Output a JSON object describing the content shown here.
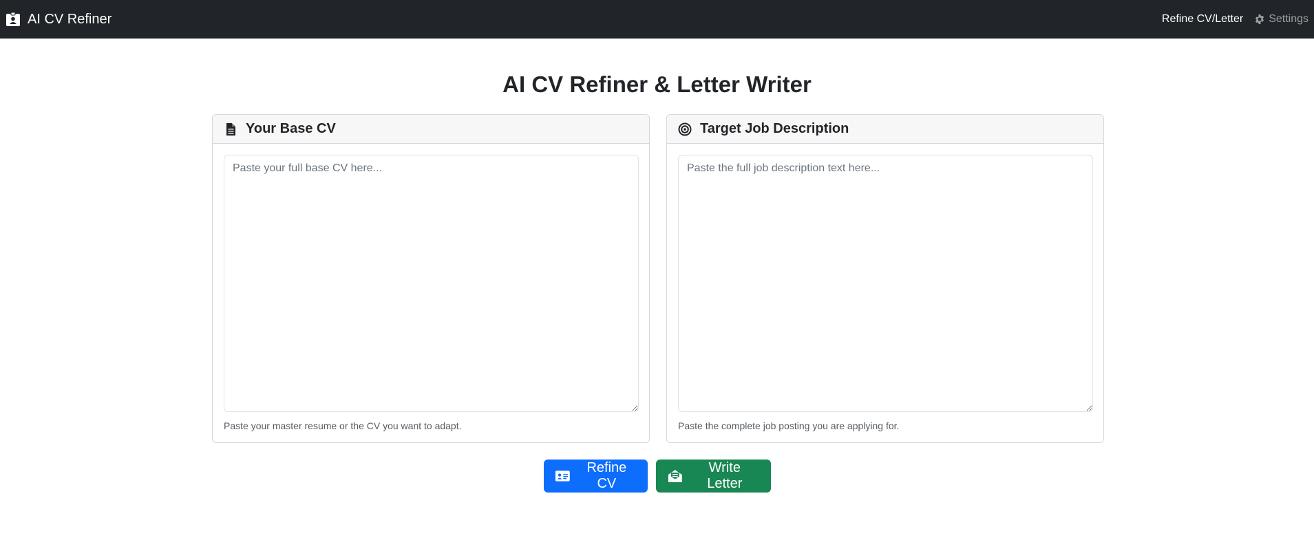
{
  "navbar": {
    "brand": "AI CV Refiner",
    "links": [
      {
        "label": "Refine CV/Letter",
        "icon": "none"
      },
      {
        "label": "Settings",
        "icon": "gear-icon"
      }
    ]
  },
  "main": {
    "title": "AI CV Refiner & Letter Writer",
    "cards": [
      {
        "header": "Your Base CV",
        "icon": "file-text-icon",
        "textarea_value": "",
        "placeholder": "Paste your full base CV here...",
        "help_text": "Paste your master resume or the CV you want to adapt."
      },
      {
        "header": "Target Job Description",
        "icon": "bullseye-icon",
        "textarea_value": "",
        "placeholder": "Paste the full job description text here...",
        "help_text": "Paste the complete job posting you are applying for."
      }
    ],
    "buttons": [
      {
        "label": "Refine CV",
        "icon": "id-card-icon",
        "color": "#0d6efd"
      },
      {
        "label": "Write Letter",
        "icon": "envelope-open-icon",
        "color": "#198754"
      }
    ]
  },
  "colors": {
    "navbar_bg": "#212529",
    "primary": "#0d6efd",
    "success": "#198754"
  }
}
